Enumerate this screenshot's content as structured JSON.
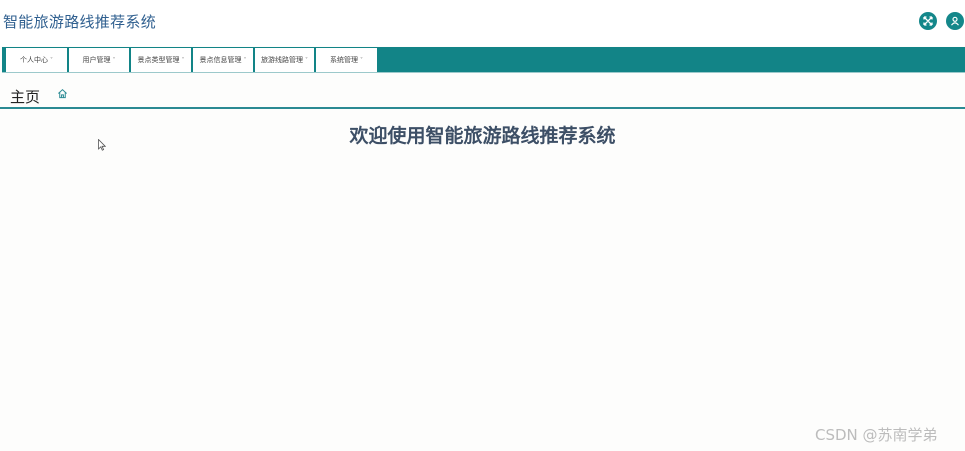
{
  "app": {
    "title": "智能旅游路线推荐系统"
  },
  "header_icons": [
    "fullscreen-icon",
    "user-icon"
  ],
  "nav": {
    "items": [
      {
        "label": "个人中心"
      },
      {
        "label": "用户管理"
      },
      {
        "label": "景点类型管理"
      },
      {
        "label": "景点信息管理"
      },
      {
        "label": "旅游线路管理"
      },
      {
        "label": "系统管理"
      }
    ],
    "caret": "˅"
  },
  "breadcrumb": {
    "label": "主页"
  },
  "main": {
    "welcome": "欢迎使用智能旅游路线推荐系统"
  },
  "watermark": "CSDN @苏南学弟",
  "colors": {
    "accent": "#128487",
    "title": "#2f5f8f",
    "welcome": "#3d4f66"
  }
}
